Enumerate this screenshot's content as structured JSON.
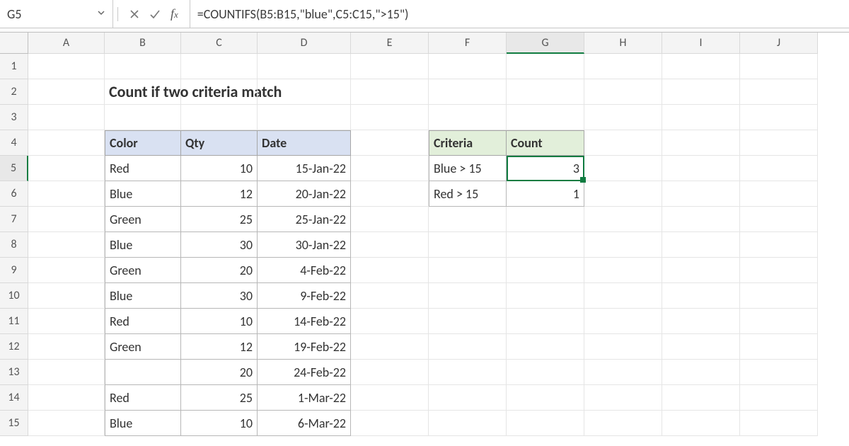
{
  "namebox": "G5",
  "formula": "=COUNTIFS(B5:B15,\"blue\",C5:C15,\">15\")",
  "title": "Count if two criteria match",
  "columns": [
    "A",
    "B",
    "C",
    "D",
    "E",
    "F",
    "G",
    "H",
    "I",
    "J"
  ],
  "rows": [
    "1",
    "2",
    "3",
    "4",
    "5",
    "6",
    "7",
    "8",
    "9",
    "10",
    "11",
    "12",
    "13",
    "14",
    "15"
  ],
  "selected_col": "G",
  "selected_row": "5",
  "table1": {
    "headers": {
      "color": "Color",
      "qty": "Qty",
      "date": "Date"
    },
    "rows": [
      {
        "color": "Red",
        "qty": "10",
        "date": "15-Jan-22"
      },
      {
        "color": "Blue",
        "qty": "12",
        "date": "20-Jan-22"
      },
      {
        "color": "Green",
        "qty": "25",
        "date": "25-Jan-22"
      },
      {
        "color": "Blue",
        "qty": "30",
        "date": "30-Jan-22"
      },
      {
        "color": "Green",
        "qty": "20",
        "date": "4-Feb-22"
      },
      {
        "color": "Blue",
        "qty": "30",
        "date": "9-Feb-22"
      },
      {
        "color": "Red",
        "qty": "10",
        "date": "14-Feb-22"
      },
      {
        "color": "Green",
        "qty": "12",
        "date": "19-Feb-22"
      },
      {
        "color": "",
        "qty": "20",
        "date": "24-Feb-22"
      },
      {
        "color": "Red",
        "qty": "25",
        "date": "1-Mar-22"
      },
      {
        "color": "Blue",
        "qty": "10",
        "date": "6-Mar-22"
      }
    ]
  },
  "table2": {
    "headers": {
      "criteria": "Criteria",
      "count": "Count"
    },
    "rows": [
      {
        "criteria": "Blue > 15",
        "count": "3"
      },
      {
        "criteria": "Red > 15",
        "count": "1"
      }
    ]
  }
}
